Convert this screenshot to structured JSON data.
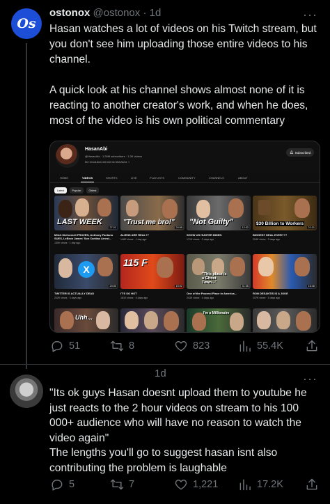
{
  "tweet1": {
    "display_name": "ostonox",
    "handle": "@ostonox",
    "separator": "·",
    "time": "1d",
    "avatar_text": "Os",
    "more": "···",
    "text_para1": "Hasan watches a lot of videos on his Twitch stream, but you don't see him uploading those entire videos to his channel.",
    "text_para2": "A quick look at his channel shows almost none of it is reacting to another creator's work, and when he does, most of the video is his own political commentary",
    "actions": {
      "replies": "51",
      "reposts": "8",
      "likes": "823",
      "views": "55.4K"
    }
  },
  "youtube": {
    "channel_name": "HasanAbi",
    "channel_meta": "@HasanAbi · 1.26M subscribers · 1.3K videos",
    "channel_desc": "the revolution will not be televised. >",
    "subscribe_label": "Subscribed",
    "tabs": [
      "HOME",
      "VIDEOS",
      "SHORTS",
      "LIVE",
      "PLAYLISTS",
      "COMMUNITY",
      "CHANNELS",
      "ABOUT"
    ],
    "active_tab": "VIDEOS",
    "chips": [
      "Latest",
      "Popular",
      "Oldest"
    ],
    "videos_row1": [
      {
        "caption": "LAST WEEK",
        "duration": "27:21",
        "title": "Mitch McConnell FROZEN, Anthony Fantano SUES, LeBron James' Son Cardiac Arrest...",
        "meta": "130K views · 1 day ago"
      },
      {
        "caption": "\"Trust me bro!\"",
        "duration": "24:55",
        "title": "ALIENS ARE REAL??",
        "meta": "148K views · 1 day ago"
      },
      {
        "caption": "\"Not Guilty\"",
        "duration": "12:32",
        "title": "SHOW US HUNTER BIDEN",
        "meta": "171K views · 2 days ago"
      },
      {
        "caption": "$30 Billion to Workers",
        "duration": "21:21",
        "title": "BIGGEST DEAL EVER???",
        "meta": "204K views · 3 days ago"
      }
    ],
    "videos_row2": [
      {
        "caption": "",
        "duration": "24:03",
        "title": "TWITTER IS ACTUALLY DEAD",
        "meta": "202K views · 3 days ago"
      },
      {
        "caption": "115 F",
        "duration": "15:02",
        "title": "IT'S SO HOT",
        "meta": "181K views · 4 days ago"
      },
      {
        "caption": "\"This place is a Ghost Town...\"",
        "duration": "31:36",
        "title": "One of the Poorest Place in America...",
        "meta": "243K views · 4 days ago"
      },
      {
        "caption": "",
        "duration": "16:46",
        "title": "RON DESANTIS IS A JOKE",
        "meta": "207K views · 5 days ago"
      }
    ],
    "videos_row3": [
      {
        "caption": "Uhh..."
      },
      {
        "caption": ""
      },
      {
        "caption": "I'm a Millionaire"
      },
      {
        "caption": ""
      }
    ]
  },
  "tweet2": {
    "time": "1d",
    "more": "···",
    "text_line1": "\"Its ok guys Hasan doesnt upload them to youtube he just reacts to the 2 hour videos on stream to his 100 000+ audience who will have no reason to watch the video again\"",
    "text_line2": "The lengths you'll go to suggest hasan isnt also contributing the problem is laughable",
    "actions": {
      "replies": "5",
      "reposts": "7",
      "likes": "1,221",
      "views": "17.2K"
    }
  },
  "colors": {
    "background": "#000000",
    "text": "#e7e9ea",
    "muted": "#71767b",
    "avatar_blue": "#1d4ed8"
  }
}
